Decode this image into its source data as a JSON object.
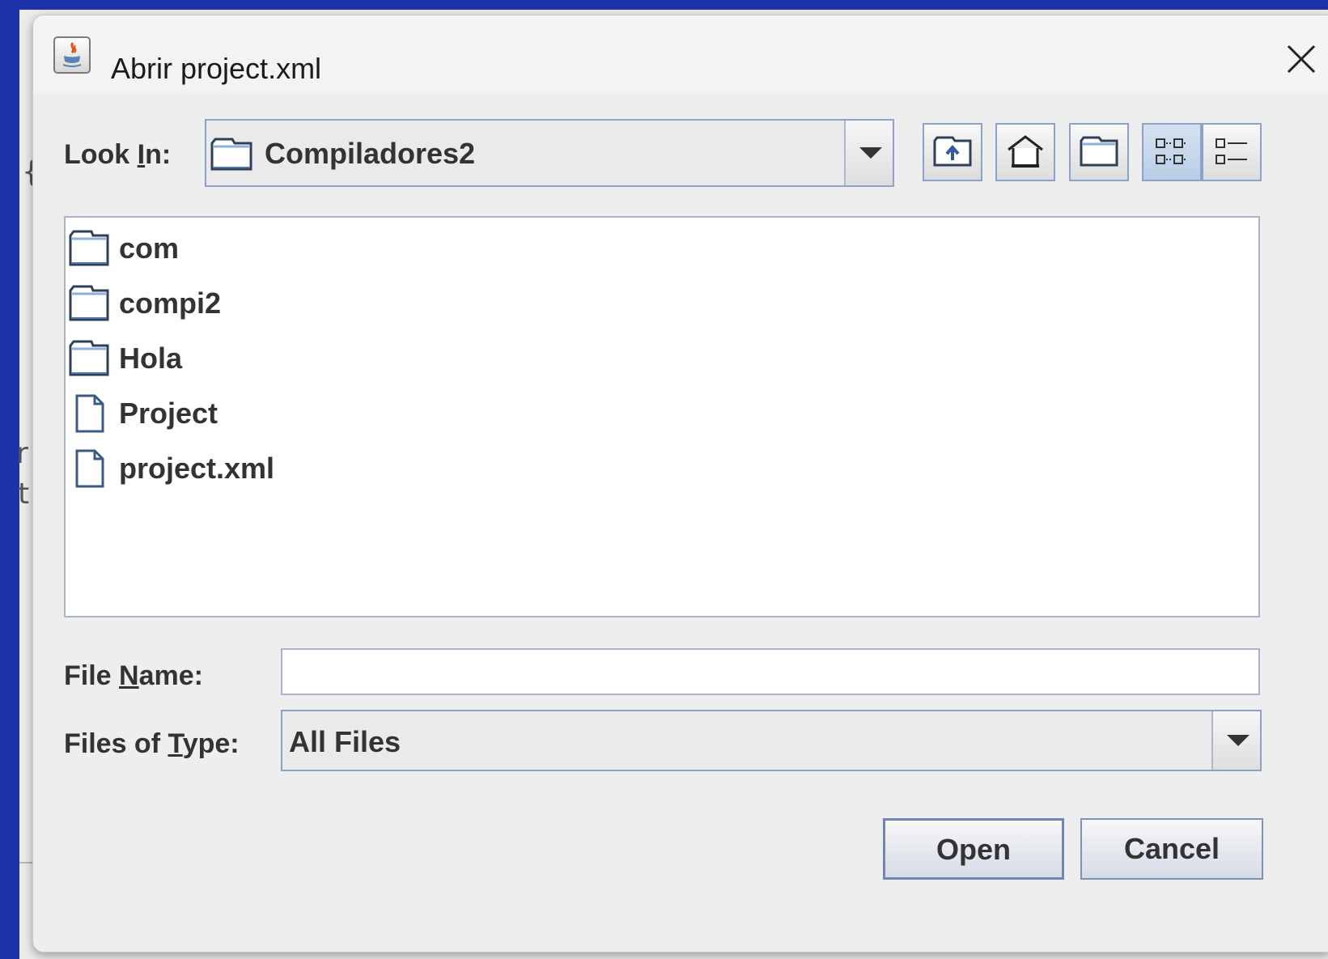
{
  "dialog": {
    "title": "Abrir project.xml"
  },
  "look_in": {
    "label_pre": "Look ",
    "label_mnemonic": "I",
    "label_post": "n:",
    "value": "Compiladores2"
  },
  "toolbar": {
    "icons": [
      "up-one-level-icon",
      "home-icon",
      "new-folder-icon",
      "list-view-icon",
      "details-view-icon"
    ]
  },
  "files": [
    {
      "name": "com",
      "type": "folder"
    },
    {
      "name": "compi2",
      "type": "folder"
    },
    {
      "name": "Hola",
      "type": "folder"
    },
    {
      "name": "Project",
      "type": "file"
    },
    {
      "name": "project.xml",
      "type": "file"
    }
  ],
  "file_name": {
    "label_pre": "File ",
    "label_mnemonic": "N",
    "label_post": "ame:",
    "value": ""
  },
  "files_of_type": {
    "label_pre": "Files of ",
    "label_mnemonic": "T",
    "label_post": "ype:",
    "value": "All Files"
  },
  "buttons": {
    "open": "Open",
    "cancel": "Cancel"
  },
  "background_fragments": [
    "{",
    "r",
    "t"
  ]
}
